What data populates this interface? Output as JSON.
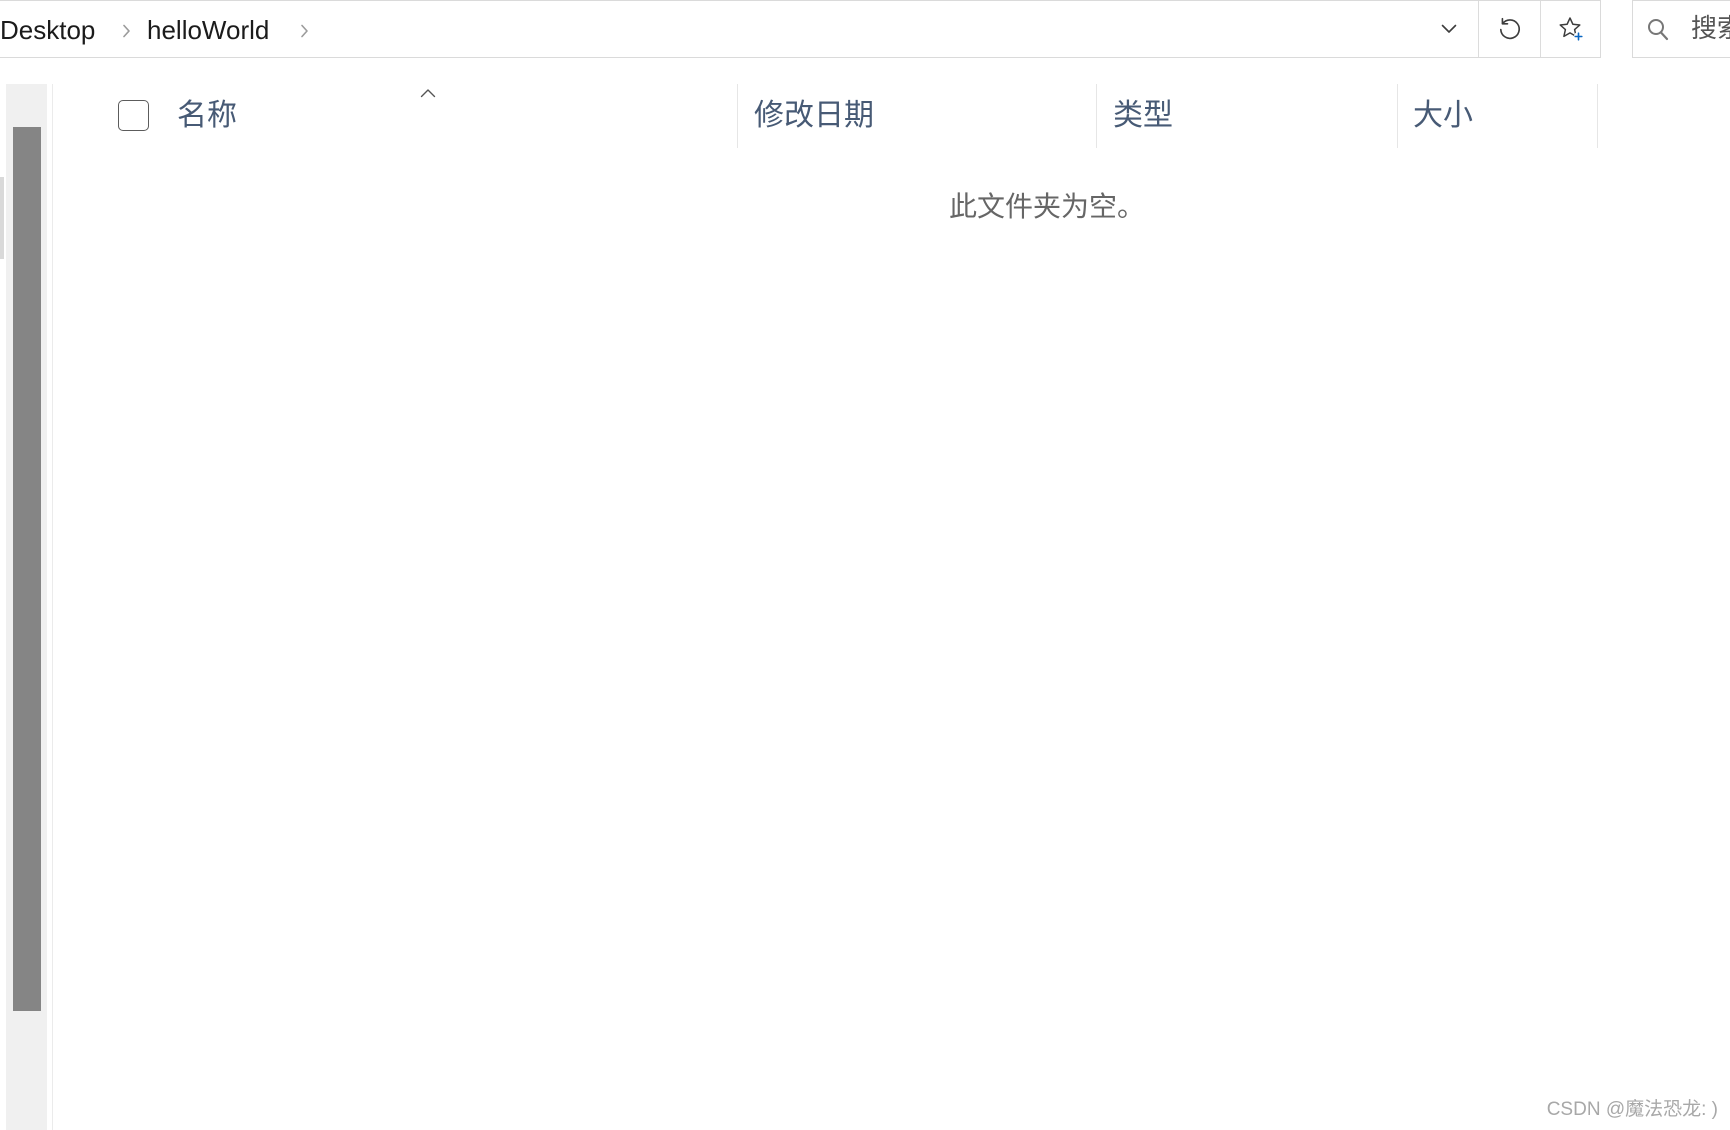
{
  "address_bar": {
    "breadcrumbs": [
      {
        "label": "Desktop"
      },
      {
        "label": "helloWorld"
      }
    ]
  },
  "search": {
    "placeholder": "搜索"
  },
  "file_list": {
    "select_all_checked": false,
    "columns": [
      {
        "label": "名称"
      },
      {
        "label": "修改日期"
      },
      {
        "label": "类型"
      },
      {
        "label": "大小"
      }
    ],
    "empty_message": "此文件夹为空。"
  },
  "watermark": "CSDN @魔法恐龙: )",
  "icons": {
    "breadcrumb_separator": "chevron-right-icon",
    "address_dropdown": "chevron-down-icon",
    "refresh": "refresh-icon",
    "add_to_favorites": "star-plus-icon",
    "search": "search-icon",
    "sort_indicator": "chevron-up-icon"
  },
  "colors": {
    "column_header_text": "#475a75",
    "empty_message_text": "#666666",
    "favorites_plus_accent": "#0b67c2",
    "scrollbar_thumb": "#858585",
    "scrollbar_track": "#f0f0f0"
  }
}
